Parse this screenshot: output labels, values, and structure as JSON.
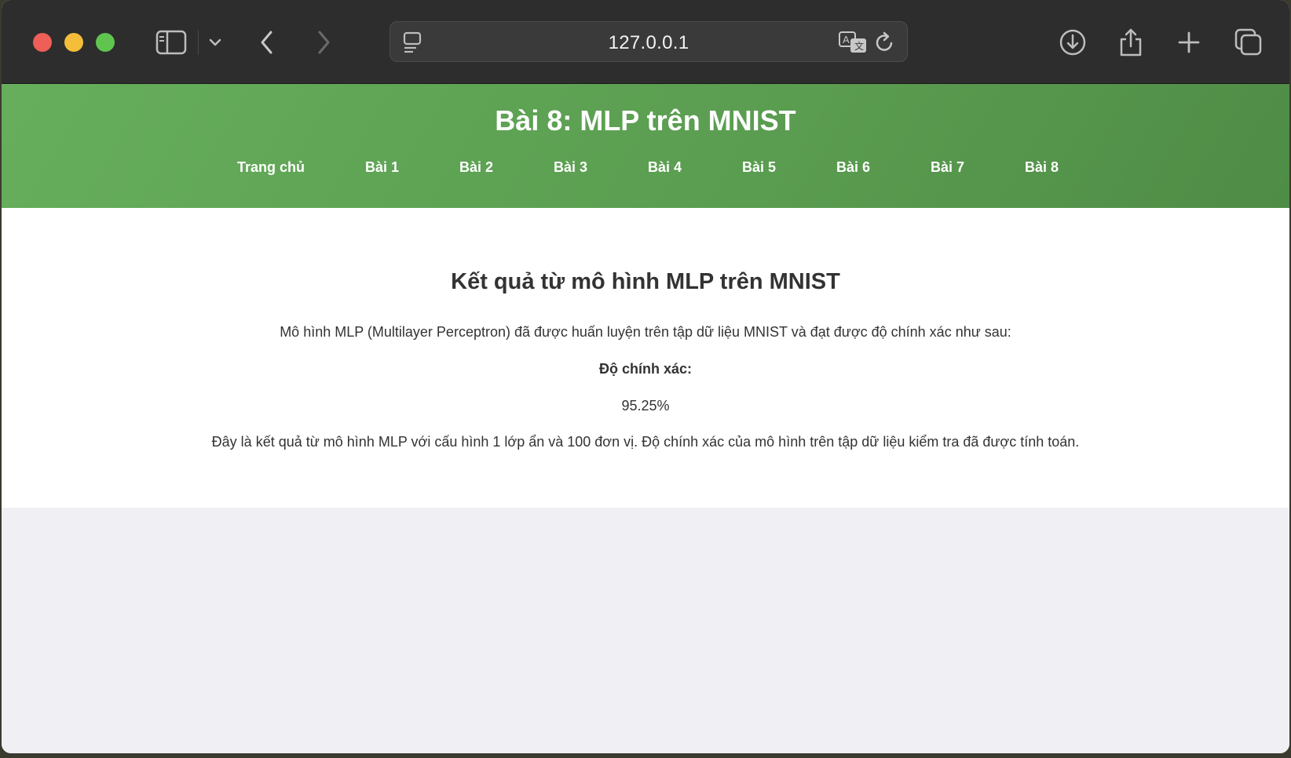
{
  "browser": {
    "url": "127.0.0.1"
  },
  "site": {
    "title": "Bài 8: MLP trên MNIST",
    "nav": [
      "Trang chủ",
      "Bài 1",
      "Bài 2",
      "Bài 3",
      "Bài 4",
      "Bài 5",
      "Bài 6",
      "Bài 7",
      "Bài 8"
    ]
  },
  "main": {
    "heading": "Kết quả từ mô hình MLP trên MNIST",
    "intro": "Mô hình MLP (Multilayer Perceptron) đã được huấn luyện trên tập dữ liệu MNIST và đạt được độ chính xác như sau:",
    "accuracy_label": "Độ chính xác:",
    "accuracy_value": "95.25%",
    "conclusion": "Đây là kết quả từ mô hình MLP với cấu hình 1 lớp ẩn và 100 đơn vị. Độ chính xác của mô hình trên tập dữ liệu kiểm tra đã được tính toán."
  },
  "colors": {
    "header_green": "#5ea655",
    "toolbar": "#2d2d2d",
    "text": "#333333"
  }
}
